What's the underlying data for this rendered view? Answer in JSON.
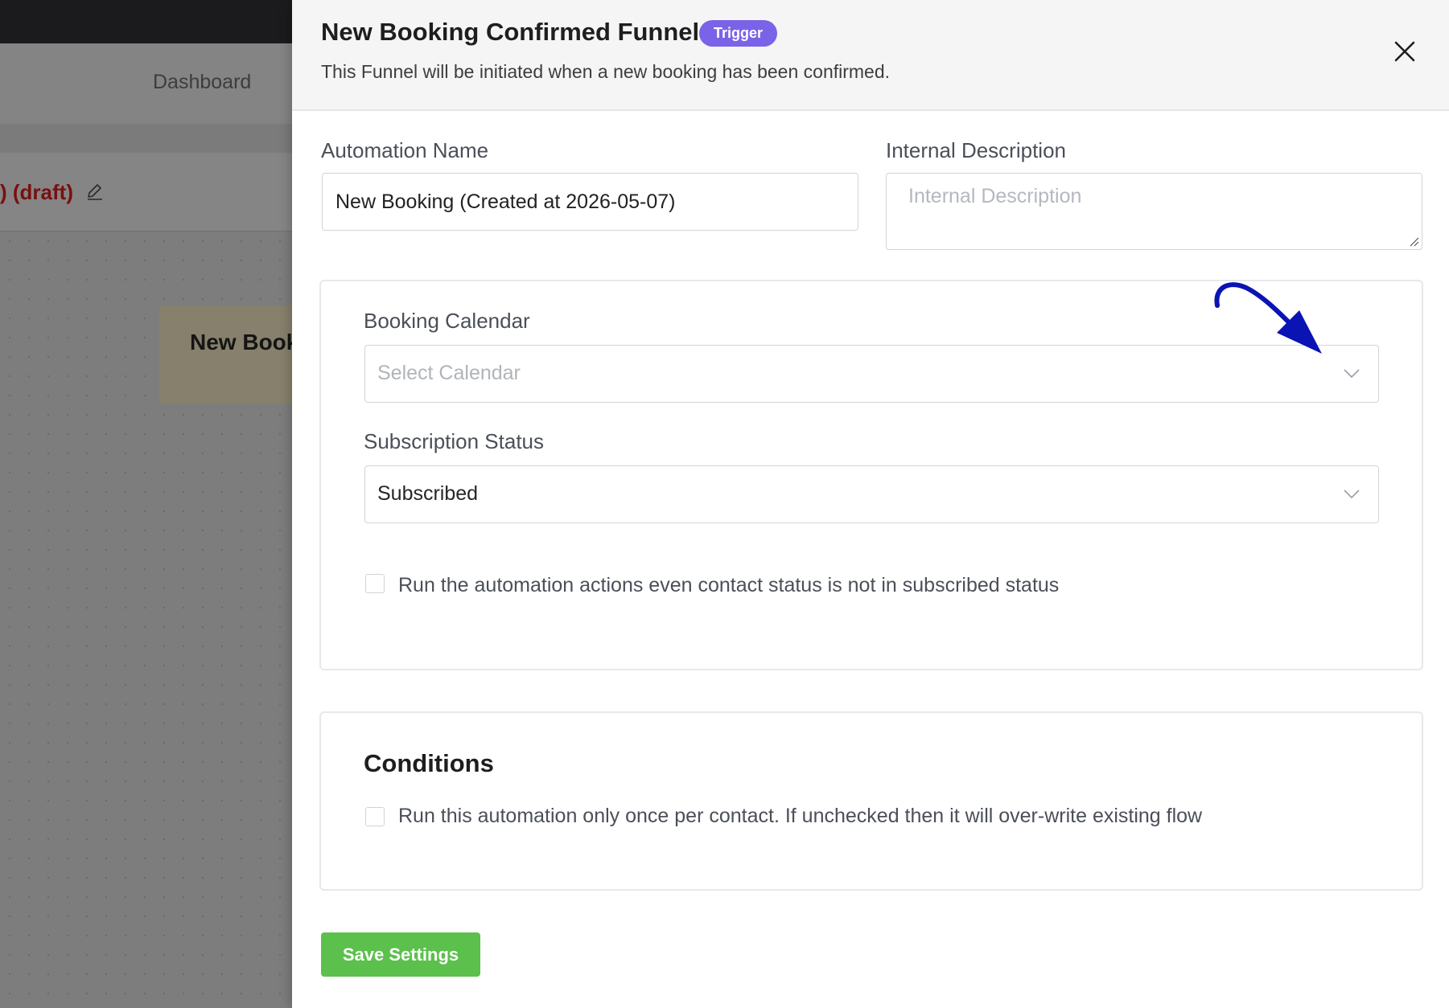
{
  "background": {
    "nav_item": "Dashboard",
    "status": ") (draft)",
    "node_label": "New Booki",
    "colors": {
      "status": "#7a0f0f"
    }
  },
  "drawer": {
    "title": "New Booking Confirmed Funnel",
    "badge": "Trigger",
    "subtitle": "This Funnel will be initiated when a new booking has been confirmed.",
    "close_icon": "close-icon",
    "colors": {
      "badge": "#7b63e8",
      "save_button": "#5cc04c"
    }
  },
  "form": {
    "automation_name": {
      "label": "Automation Name",
      "value": "New Booking (Created at 2026-05-07)"
    },
    "internal_description": {
      "label": "Internal Description",
      "placeholder": "Internal Description"
    },
    "booking_calendar": {
      "label": "Booking Calendar",
      "placeholder": "Select Calendar"
    },
    "subscription_status": {
      "label": "Subscription Status",
      "value": "Subscribed"
    },
    "run_even_unsubscribed": {
      "label": "Run the automation actions even contact status is not in subscribed status",
      "checked": false
    }
  },
  "conditions": {
    "heading": "Conditions",
    "run_once": {
      "label": "Run this automation only once per contact. If unchecked then it will over-write existing flow",
      "checked": false
    }
  },
  "actions": {
    "save": "Save Settings"
  }
}
